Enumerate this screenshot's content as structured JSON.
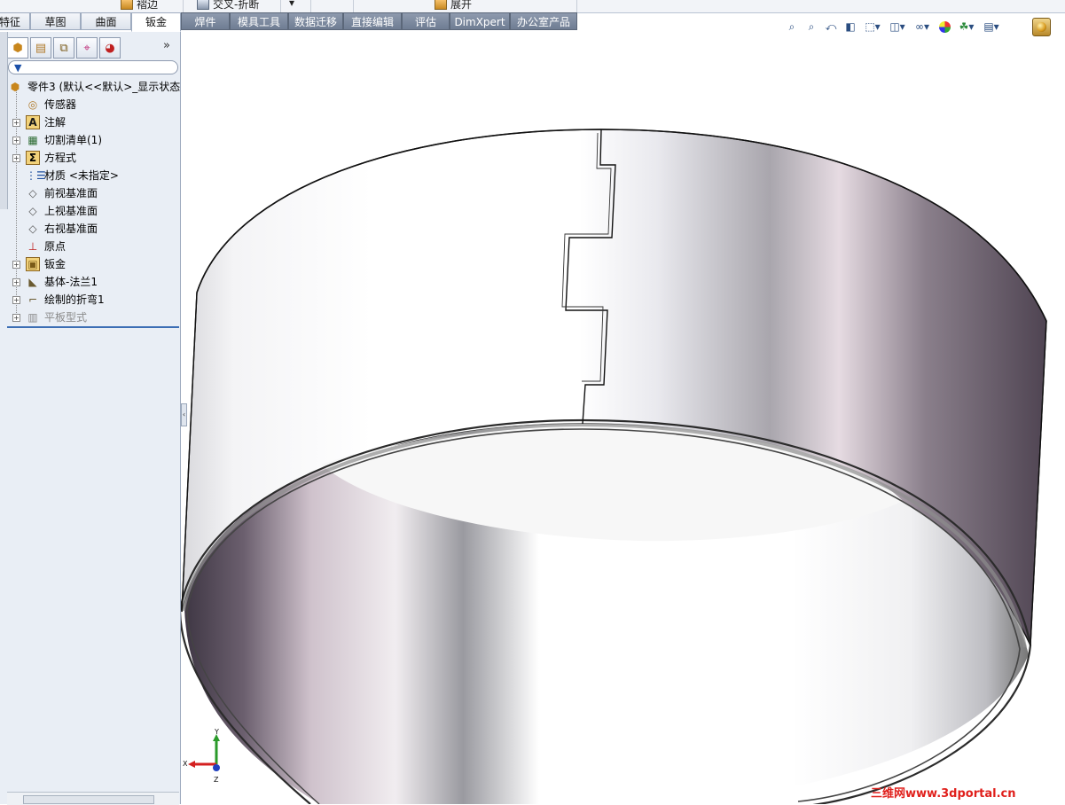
{
  "ribbon": {
    "items": [
      {
        "label": "褶边"
      },
      {
        "label": "交叉-折断"
      },
      {
        "label": "展开"
      }
    ],
    "more": "▾"
  },
  "tabs": [
    "特征",
    "草图",
    "曲面",
    "钣金",
    "焊件",
    "模具工具",
    "数据迁移",
    "直接编辑",
    "评估",
    "DimXpert",
    "办公室产品"
  ],
  "active_tab": "钣金",
  "panel": {
    "expand_label": "»",
    "tree": [
      {
        "label": "零件3  (默认<<默认>_显示状态",
        "icon": "part-icon"
      },
      {
        "label": "传感器",
        "icon": "sensor-icon"
      },
      {
        "label": "注解",
        "icon": "annotation-icon"
      },
      {
        "label": "切割清单(1)",
        "icon": "cutlist-icon"
      },
      {
        "label": "方程式",
        "icon": "equation-icon"
      },
      {
        "label": "材质 <未指定>",
        "icon": "material-icon"
      },
      {
        "label": "前视基准面",
        "icon": "plane-icon"
      },
      {
        "label": "上视基准面",
        "icon": "plane-icon"
      },
      {
        "label": "右视基准面",
        "icon": "plane-icon"
      },
      {
        "label": "原点",
        "icon": "origin-icon"
      },
      {
        "label": "钣金",
        "icon": "sheetmetal-icon"
      },
      {
        "label": "基体-法兰1",
        "icon": "base-flange-icon"
      },
      {
        "label": "绘制的折弯1",
        "icon": "sketched-bend-icon"
      },
      {
        "label": "平板型式",
        "icon": "flat-pattern-icon"
      }
    ]
  },
  "triad": {
    "x": "X",
    "y": "Y",
    "z": "Z"
  },
  "watermark": "三维网www.3dportal.cn",
  "colors": {
    "accent": "#3c6eb4",
    "watermark": "#e0201c"
  }
}
